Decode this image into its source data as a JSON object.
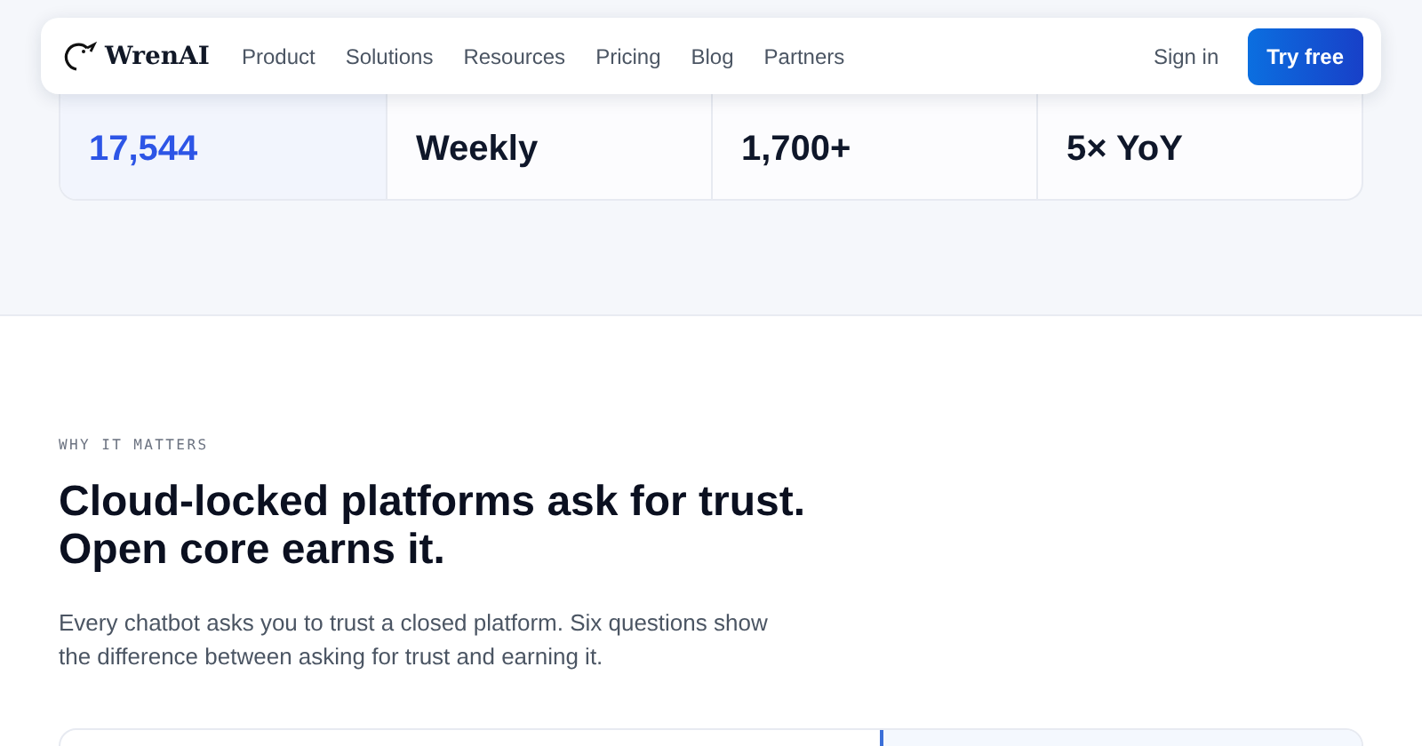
{
  "nav": {
    "brand": "WrenAI",
    "links": [
      "Product",
      "Solutions",
      "Resources",
      "Pricing",
      "Blog",
      "Partners"
    ],
    "sign_in": "Sign in",
    "cta": "Try free"
  },
  "stats": [
    {
      "value": "17,544",
      "selected": true
    },
    {
      "value": "Weekly",
      "selected": false
    },
    {
      "value": "1,700+",
      "selected": false
    },
    {
      "value": "5× YoY",
      "selected": false
    }
  ],
  "section": {
    "eyebrow": "WHY IT MATTERS",
    "heading_lines": [
      "Cloud-locked platforms ask for trust.",
      "Open core earns it."
    ],
    "body": "Every chatbot asks you to trust a closed platform. Six questions show the difference between asking for trust and earning it."
  }
}
